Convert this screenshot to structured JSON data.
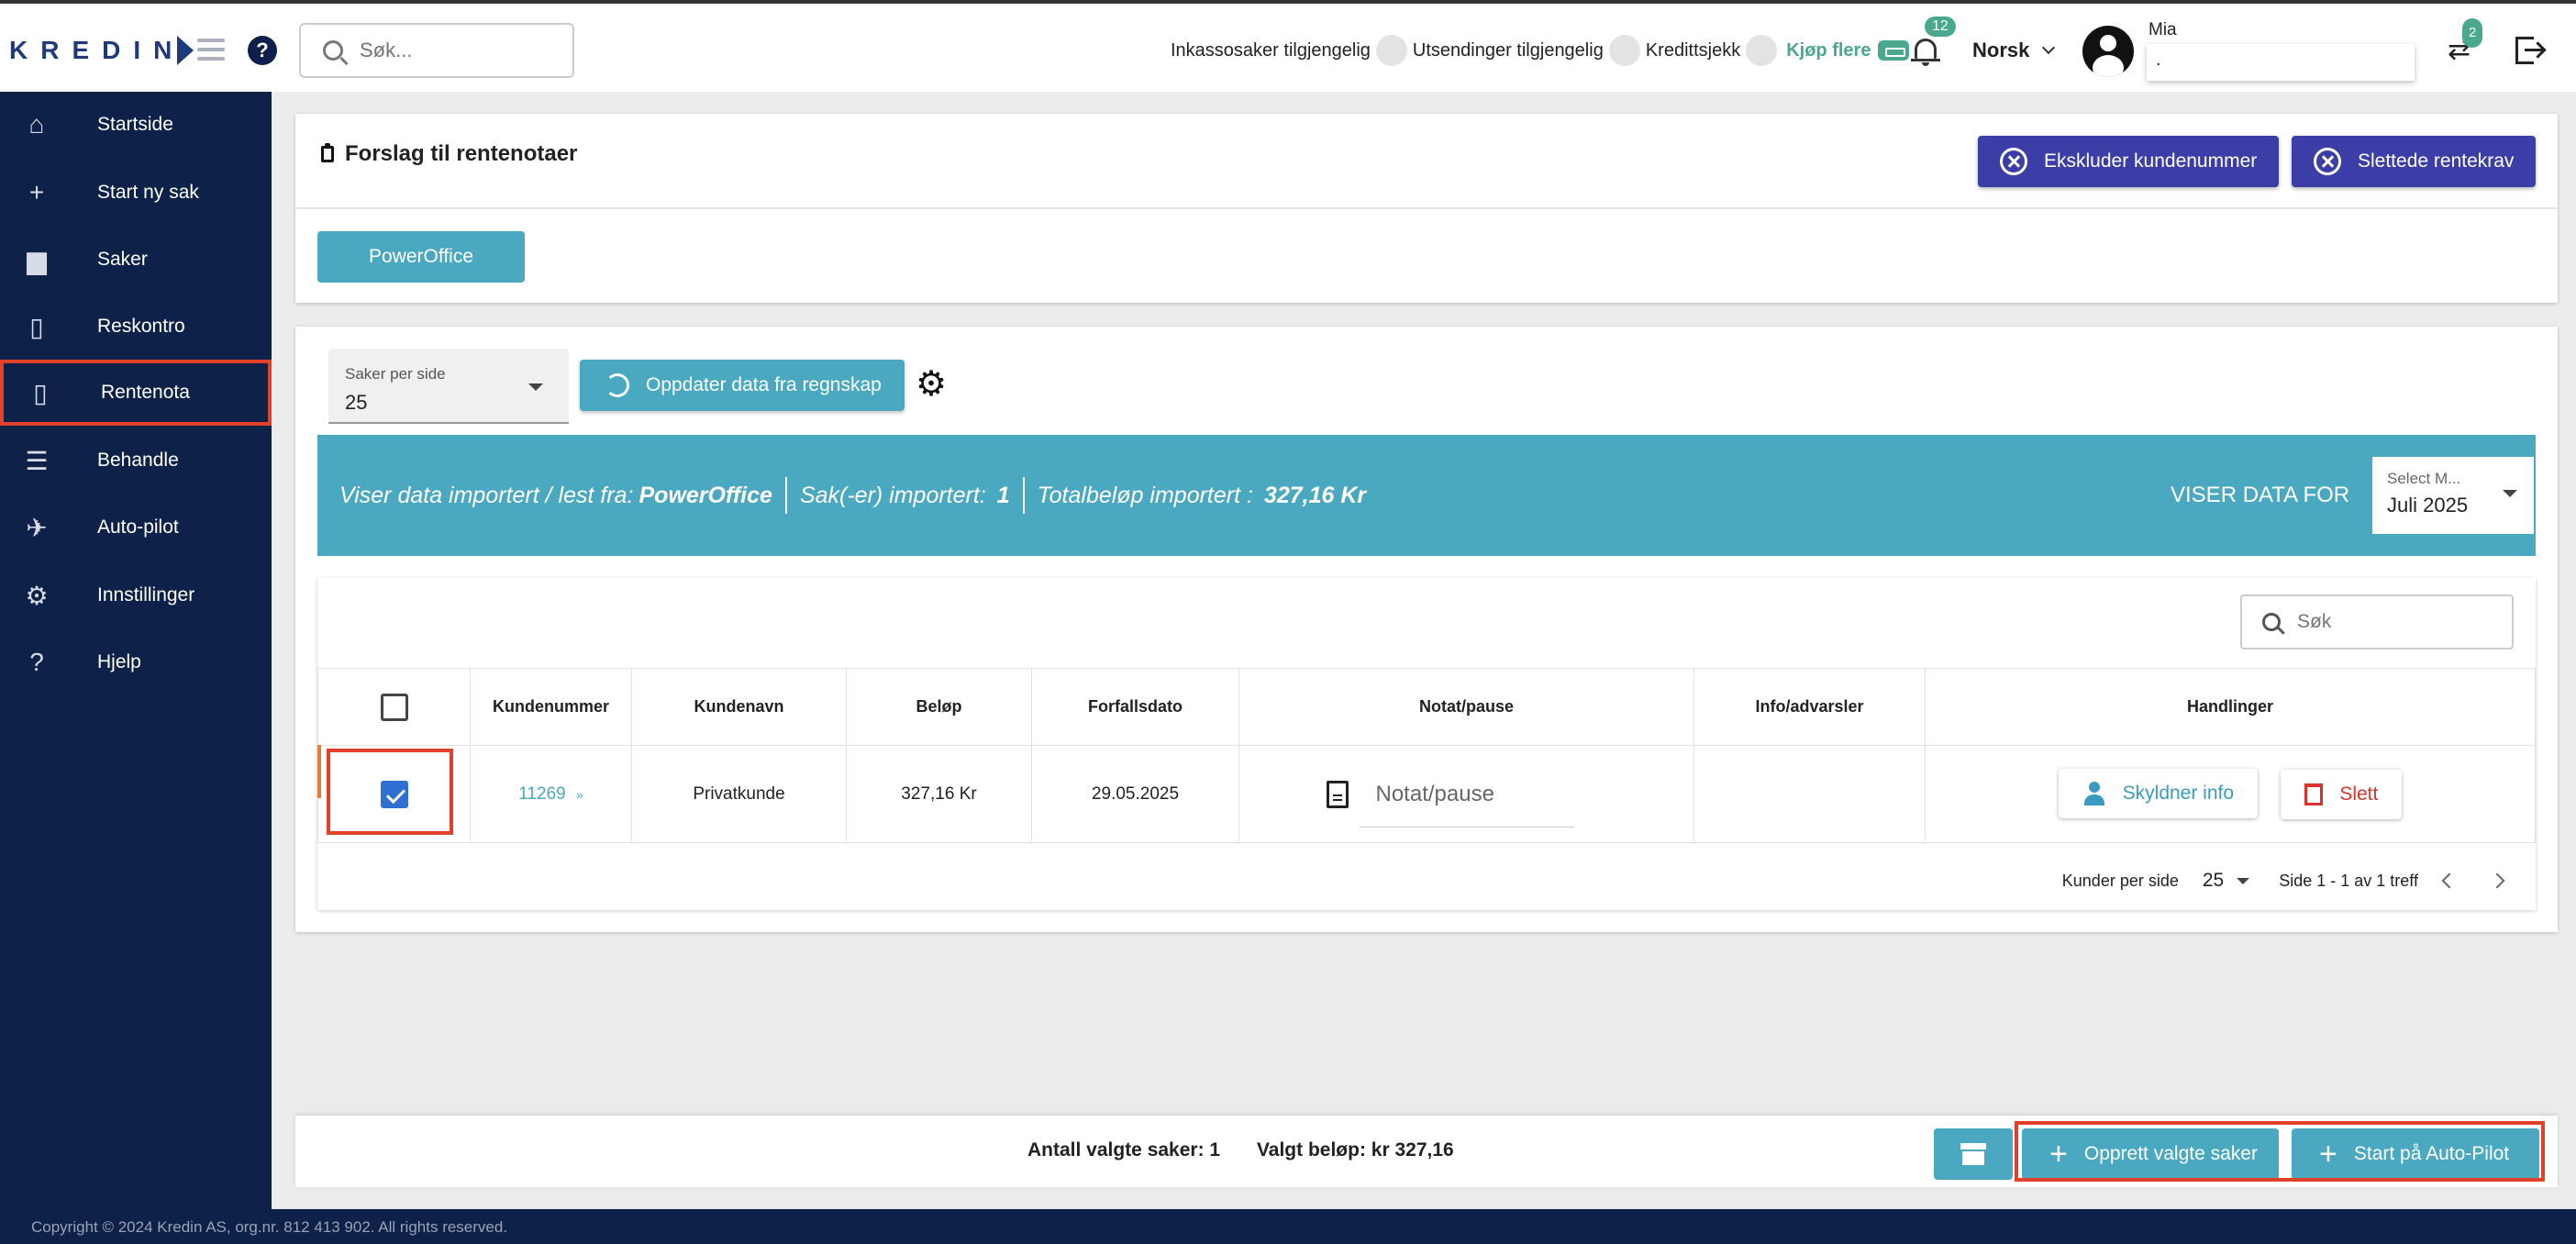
{
  "header": {
    "logo": "KREDIN",
    "search_placeholder": "Søk...",
    "toggles": [
      "Inkassosaker tilgjengelig",
      "Utsendinger tilgjengelig",
      "Kredittsjekk"
    ],
    "buy_more": "Kjøp flere",
    "notifications_count": "12",
    "language": "Norsk",
    "user_name": "Mia",
    "user_field_value": ".",
    "transfer_count": "2"
  },
  "sidebar": {
    "items": [
      {
        "label": "Startside",
        "icon": "home-icon"
      },
      {
        "label": "Start ny sak",
        "icon": "plus-icon"
      },
      {
        "label": "Saker",
        "icon": "briefcase-icon"
      },
      {
        "label": "Reskontro",
        "icon": "document-icon"
      },
      {
        "label": "Rentenota",
        "icon": "document-icon",
        "active": true
      },
      {
        "label": "Behandle",
        "icon": "checklist-icon"
      },
      {
        "label": "Auto-pilot",
        "icon": "airplane-icon"
      },
      {
        "label": "Innstillinger",
        "icon": "gear-icon"
      },
      {
        "label": "Hjelp",
        "icon": "question-icon"
      }
    ],
    "copyright": "Copyright © 2024 Kredin AS, org.nr. 812 413 902. All rights reserved."
  },
  "page": {
    "title": "Forslag til rentenotaer",
    "exclude_button": "Ekskluder kundenummer",
    "deleted_button": "Slettede rentekrav",
    "source_button": "PowerOffice"
  },
  "controls": {
    "per_page_label": "Saker per side",
    "per_page_value": "25",
    "update_button": "Oppdater data fra regnskap"
  },
  "info": {
    "prefix": "Viser data importert / lest fra:",
    "source": "PowerOffice",
    "cases_label": "Sak(-er) importert:",
    "cases_value": "1",
    "total_label": "Totalbeløp importert :",
    "total_value": "327,16 Kr",
    "viewing_for": "VISER DATA FOR",
    "month_label": "Select M...",
    "month_value": "Juli 2025"
  },
  "table": {
    "search_placeholder": "Søk",
    "headers": [
      "Kundenummer",
      "Kundenavn",
      "Beløp",
      "Forfallsdato",
      "Notat/pause",
      "Info/advarsler",
      "Handlinger"
    ],
    "rows": [
      {
        "customer_number": "11269",
        "customer_name": "Privatkunde",
        "amount": "327,16 Kr",
        "due_date": "29.05.2025",
        "note_placeholder": "Notat/pause",
        "info": "",
        "debtor_button": "Skyldner info",
        "delete_button": "Slett",
        "checked": true
      }
    ],
    "pagination": {
      "per_page_label": "Kunder per side",
      "per_page_value": "25",
      "range": "Side 1 - 1 av 1 treff"
    }
  },
  "footer": {
    "selected_count": "Antall valgte saker: 1",
    "selected_amount": "Valgt beløp: kr 327,16",
    "create_button": "Opprett valgte saker",
    "autopilot_button": "Start på Auto-Pilot"
  },
  "colors": {
    "sidebar_bg": "#0e2148",
    "accent_teal": "#4aa8c0",
    "purple_button": "#3d3da8",
    "highlight_red": "#e2402a",
    "badge_green": "#4aa88f"
  }
}
